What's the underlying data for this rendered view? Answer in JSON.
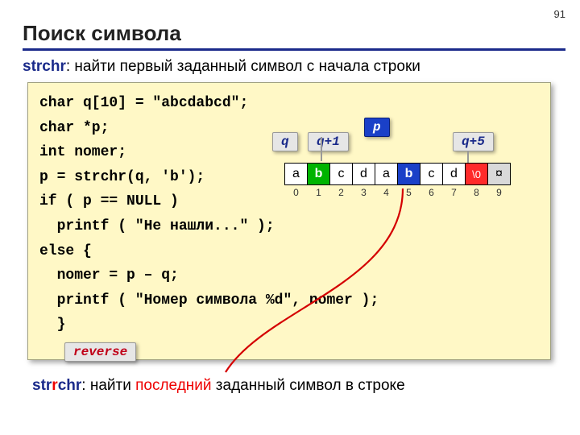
{
  "page_number": "91",
  "title": "Поиск символа",
  "strchr": {
    "name": "strchr",
    "desc": ": найти первый заданный символ с начала строки"
  },
  "code": "char q[10] = \"abcdabcd\";\nchar *p;\nint nomer;\np = strchr(q, 'b');\nif ( p == NULL )\n  printf ( \"Не нашли...\" );\nelse {\n  nomer = p – q;\n  printf ( \"Номер символа %d\", nomer );\n  }",
  "tags": {
    "q": "q",
    "q1": "q+1",
    "p": "p",
    "q5": "q+5",
    "reverse": "reverse"
  },
  "cells": [
    "a",
    "b",
    "c",
    "d",
    "a",
    "b",
    "c",
    "d",
    "\\0",
    "¤"
  ],
  "indices": [
    "0",
    "1",
    "2",
    "3",
    "4",
    "5",
    "6",
    "7",
    "8",
    "9"
  ],
  "strrchr": {
    "prefix": "str",
    "mid": "r",
    "suffix": "chr",
    "desc_before": ": найти ",
    "desc_red": "последний",
    "desc_after": " заданный символ в строке"
  }
}
